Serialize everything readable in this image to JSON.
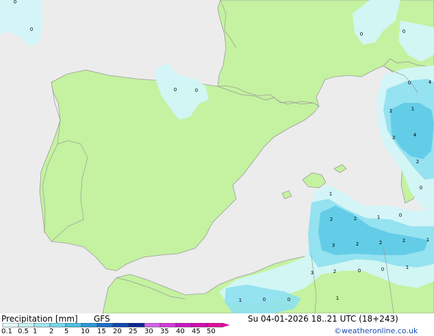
{
  "colors": {
    "sea": "#ececec",
    "land": "#c4f2a0",
    "border": "#999999",
    "coast": "#9a9a9a",
    "precip_01": "#d2f6f8",
    "precip_05": "#b6eef5",
    "precip_1": "#8ee0f0",
    "precip_2": "#5dcbe6",
    "precip_5": "#3aa8d8"
  },
  "map_labels": [
    "0",
    "0",
    "0",
    "0",
    "0",
    "0",
    "0",
    "4",
    "1",
    "2",
    "3",
    "4",
    "2",
    "0",
    "1",
    "2",
    "2",
    "1",
    "0",
    "2",
    "2",
    "2",
    "1",
    "3",
    "2",
    "0",
    "0",
    "1",
    "3",
    "1",
    "0",
    "1",
    "0"
  ],
  "legend": {
    "title": "Precipitation [mm]",
    "model": "GFS",
    "ticks": [
      "0.1",
      "0.5",
      "1",
      "2",
      "5",
      "10",
      "15",
      "20",
      "25",
      "30",
      "35",
      "40",
      "45",
      "50"
    ],
    "swatches": [
      "#e4fcfc",
      "#c8f2f4",
      "#a2e6ef",
      "#78d6ea",
      "#4cbfe4",
      "#2c98d6",
      "#1e6fc8",
      "#1548b0",
      "#0e2896",
      "#d264ec",
      "#d23cd8",
      "#c818c4",
      "#d010b0",
      "#e010a0"
    ]
  },
  "valid_time": "Su 04-01-2026 18..21 UTC (18+243)",
  "credit": "©weatheronline.co.uk"
}
